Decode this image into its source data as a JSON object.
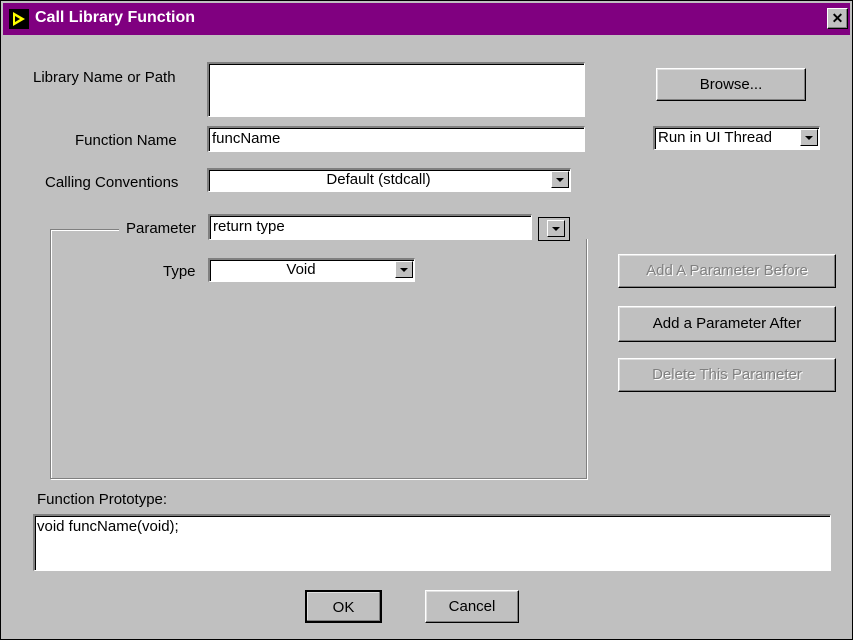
{
  "window": {
    "title": "Call Library Function",
    "close_glyph": "✕"
  },
  "form": {
    "library_label": "Library Name or Path",
    "library_value": "",
    "function_label": "Function Name",
    "function_value": "funcName",
    "calling_label": "Calling Conventions",
    "calling_value": "Default (stdcall)",
    "thread_value": "Run in UI Thread"
  },
  "buttons": {
    "browse": "Browse...",
    "add_before": "Add A Parameter Before",
    "add_after": "Add a Parameter After",
    "delete": "Delete This Parameter",
    "ok": "OK",
    "cancel": "Cancel"
  },
  "parameter": {
    "label": "Parameter",
    "value": "return type",
    "type_label": "Type",
    "type_value": "Void"
  },
  "prototype": {
    "label": "Function Prototype:",
    "value": "void funcName(void);"
  },
  "colors": {
    "title_bar": "#800080",
    "face": "#c0c0c0"
  },
  "icons": {
    "app": "labview-play-icon",
    "close": "close-icon",
    "dropdown": "dropdown-arrow-icon"
  }
}
